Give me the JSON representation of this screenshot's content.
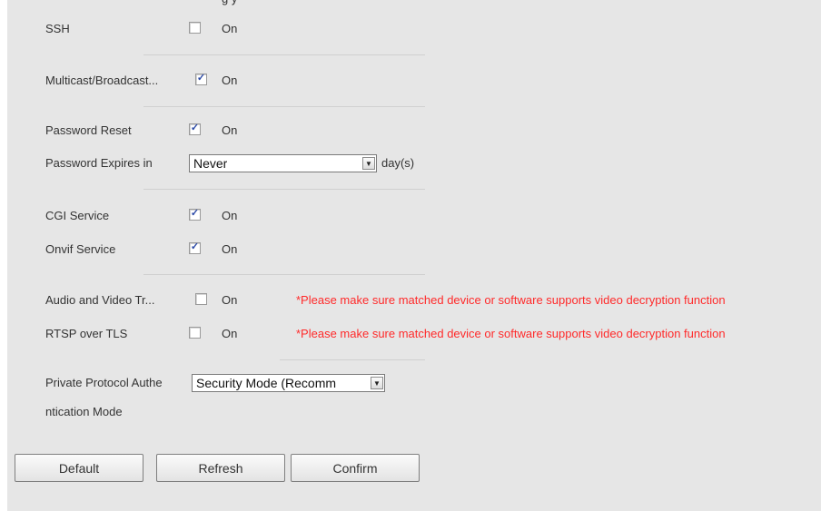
{
  "header_fragment": "g          y",
  "on_label": "On",
  "rows": {
    "ssh": {
      "label": "SSH",
      "checked": false
    },
    "multicast": {
      "label": "Multicast/Broadcast...",
      "checked": true
    },
    "password_reset": {
      "label": "Password Reset",
      "checked": true
    },
    "password_expires": {
      "label": "Password Expires in",
      "value": "Never",
      "unit": "day(s)"
    },
    "cgi": {
      "label": "CGI Service",
      "checked": true
    },
    "onvif": {
      "label": "Onvif Service",
      "checked": true
    },
    "audio_video": {
      "label": "Audio and Video Tr...",
      "checked": false,
      "note": "*Please make sure matched device or software supports video decryption function"
    },
    "rtsp_tls": {
      "label": "RTSP over TLS",
      "checked": false,
      "note": "*Please make sure matched device or software supports video decryption function"
    },
    "private_protocol": {
      "label_line1": "Private Protocol Authe",
      "label_line2": "ntication Mode",
      "value": "Security Mode (Recomm"
    }
  },
  "buttons": {
    "default": "Default",
    "refresh": "Refresh",
    "confirm": "Confirm"
  },
  "colors": {
    "background": "#e6e6e6",
    "warning": "#ff2a2a",
    "check": "#2a49a6"
  }
}
